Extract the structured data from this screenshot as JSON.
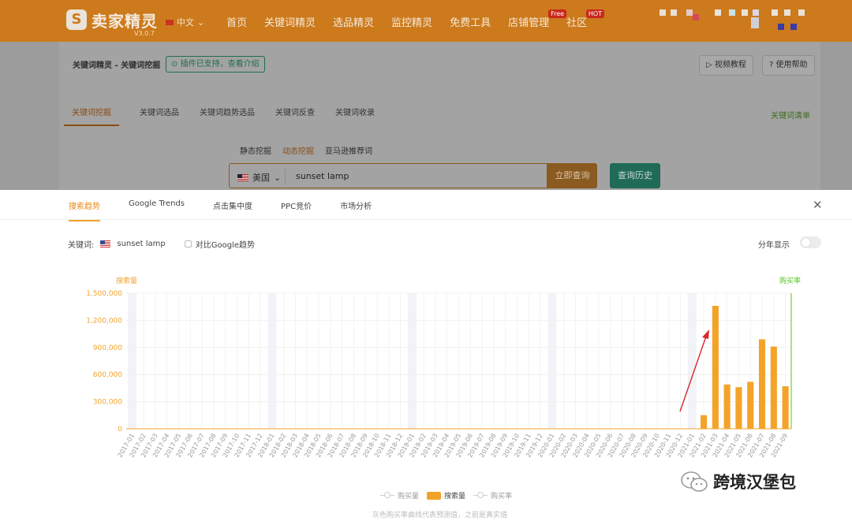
{
  "app": {
    "logo_mark": "S",
    "logo_text": "卖家精灵",
    "version": "V3.0.7",
    "language": "中文"
  },
  "nav": [
    {
      "label": "首页"
    },
    {
      "label": "关键词精灵"
    },
    {
      "label": "选品精灵"
    },
    {
      "label": "监控精灵"
    },
    {
      "label": "免费工具"
    },
    {
      "label": "店铺管理",
      "badge": "Free"
    },
    {
      "label": "社区",
      "badge": "HOT"
    }
  ],
  "page": {
    "breadcrumb": "关键词精灵 - 关键词挖掘",
    "plugin_badge": "插件已支持，查看介绍",
    "video_help": "视频教程",
    "usage_help": "使用帮助",
    "tabs": [
      "关键词挖掘",
      "关键词选品",
      "关键词趋势选品",
      "关键词反查",
      "关键词收录"
    ],
    "keyword_list": "关键词清单",
    "sub_tabs": [
      "静态挖掘",
      "动态挖掘",
      "亚马逊推荐词"
    ],
    "search": {
      "country": "美国",
      "value": "sunset lamp",
      "query_button": "立即查询",
      "history_button": "查询历史"
    }
  },
  "panel": {
    "tabs": [
      "搜索趋势",
      "Google Trends",
      "点击集中度",
      "PPC竞价",
      "市场分析"
    ],
    "keyword_label": "关键词:",
    "keyword_value": "sunset lamp",
    "compare_label": "对比Google趋势",
    "by_year_label": "分年显示",
    "legend": [
      "购买量",
      "搜索量",
      "购买率"
    ],
    "footnote": "灰色购买率曲线代表预测值，之前是真实值"
  },
  "watermark": "跨境汉堡包",
  "colors": {
    "topbar": "#cc7a1c",
    "accent": "#f4a32a",
    "tab_active": "#e58a17",
    "right_axis": "#52c41a"
  },
  "chart_data": {
    "type": "bar",
    "ylabel": "搜索量",
    "y2label": "购买率",
    "ylim": [
      0,
      1500000
    ],
    "yticks": [
      "0",
      "300,000",
      "600,000",
      "900,000",
      "1,200,000",
      "1,500,000"
    ],
    "grid": true,
    "categories": [
      "2017-01",
      "2017-02",
      "2017-03",
      "2017-04",
      "2017-05",
      "2017-06",
      "2017-07",
      "2017-08",
      "2017-09",
      "2017-10",
      "2017-11",
      "2017-12",
      "2018-01",
      "2018-02",
      "2018-03",
      "2018-04",
      "2018-05",
      "2018-06",
      "2018-07",
      "2018-08",
      "2018-09",
      "2018-10",
      "2018-11",
      "2018-12",
      "2019-01",
      "2019-02",
      "2019-03",
      "2019-04",
      "2019-05",
      "2019-06",
      "2019-07",
      "2019-08",
      "2019-09",
      "2019-10",
      "2019-11",
      "2019-12",
      "2020-01",
      "2020-02",
      "2020-03",
      "2020-04",
      "2020-05",
      "2020-06",
      "2020-07",
      "2020-08",
      "2020-09",
      "2020-10",
      "2020-11",
      "2020-12",
      "2021-01",
      "2021-02",
      "2021-03",
      "2021-04",
      "2021-05",
      "2021-06",
      "2021-07",
      "2021-08",
      "2021-09"
    ],
    "series": [
      {
        "name": "搜索量",
        "values": [
          0,
          0,
          0,
          0,
          0,
          0,
          0,
          0,
          0,
          0,
          0,
          0,
          0,
          0,
          0,
          0,
          0,
          0,
          0,
          0,
          0,
          0,
          0,
          0,
          0,
          0,
          0,
          0,
          0,
          0,
          0,
          0,
          0,
          0,
          0,
          0,
          0,
          0,
          0,
          0,
          0,
          0,
          0,
          0,
          0,
          0,
          0,
          0,
          0,
          150000,
          1360000,
          490000,
          460000,
          520000,
          990000,
          910000,
          470000
        ]
      }
    ],
    "year_start_bands": [
      "2017-01",
      "2018-01",
      "2019-01",
      "2020-01",
      "2021-01"
    ]
  }
}
